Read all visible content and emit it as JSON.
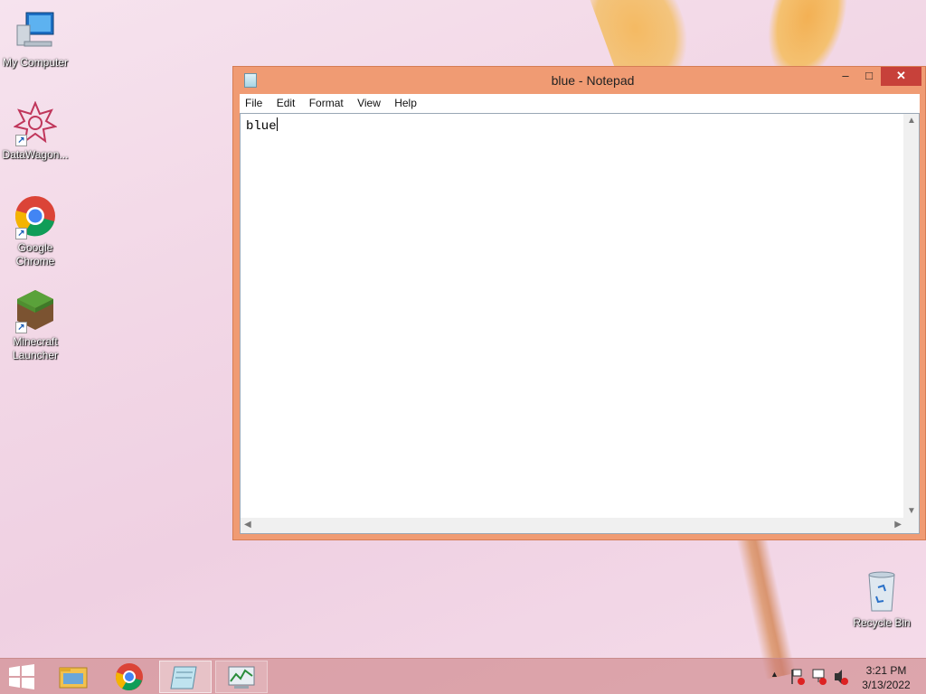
{
  "desktop": {
    "icons": [
      {
        "label": "My Computer"
      },
      {
        "label": "DataWagon..."
      },
      {
        "label": "Google Chrome"
      },
      {
        "label": "Minecraft Launcher"
      },
      {
        "label": "Recycle Bin"
      }
    ]
  },
  "notepad": {
    "title": "blue - Notepad",
    "menu": [
      "File",
      "Edit",
      "Format",
      "View",
      "Help"
    ],
    "content": "blue",
    "controls": {
      "minimize": "–",
      "maximize": "□",
      "close": "✕"
    }
  },
  "taskbar": {
    "apps": [
      "start-icon",
      "file-explorer-icon",
      "chrome-icon",
      "notepad-icon",
      "task-manager-icon"
    ],
    "clock": {
      "time": "3:21 PM",
      "date": "3/13/2022"
    }
  },
  "colors": {
    "window_frame": "#f09b73",
    "close_button": "#c7413a"
  }
}
